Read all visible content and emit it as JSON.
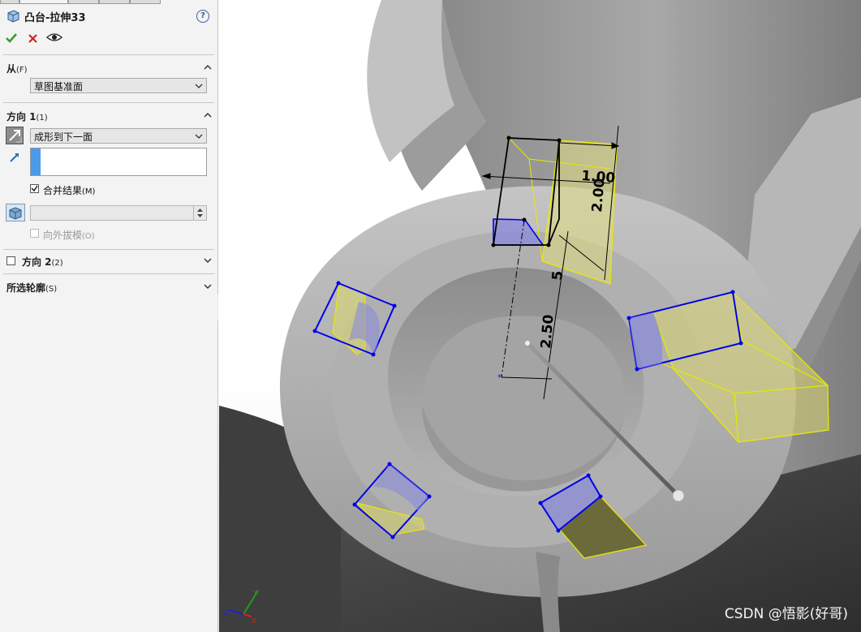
{
  "feature": {
    "title": "凸台-拉伸33",
    "help": "?"
  },
  "from_section": {
    "title": "从",
    "hotkey": "(F)",
    "condition": "草图基准面"
  },
  "direction1": {
    "title": "方向 1",
    "hotkey": "(1)",
    "end_condition": "成形到下一面",
    "merge_result": {
      "label": "合并结果",
      "hotkey": "(M)",
      "checked": true
    },
    "draft_outward": {
      "label": "向外拔模",
      "hotkey": "(O)",
      "checked": false,
      "enabled": false
    }
  },
  "direction2": {
    "title": "方向 2",
    "hotkey": "(2)",
    "checked": false
  },
  "selected_contours": {
    "title": "所选轮廓",
    "hotkey": "(S)"
  },
  "dimensions": {
    "d1": "1.00",
    "d2": "2.00",
    "d3": "5",
    "d4": "2.50"
  },
  "triad": {
    "x": "X",
    "y": "Y",
    "z": "Z"
  },
  "watermark": "CSDN @悟影(好哥)",
  "colors": {
    "accent_blue": "#4c9be8",
    "ok_green": "#2e9e2e",
    "cancel_red": "#d82020",
    "preview_yellow": "#e8e800",
    "sketch_blue": "#0000ee"
  }
}
